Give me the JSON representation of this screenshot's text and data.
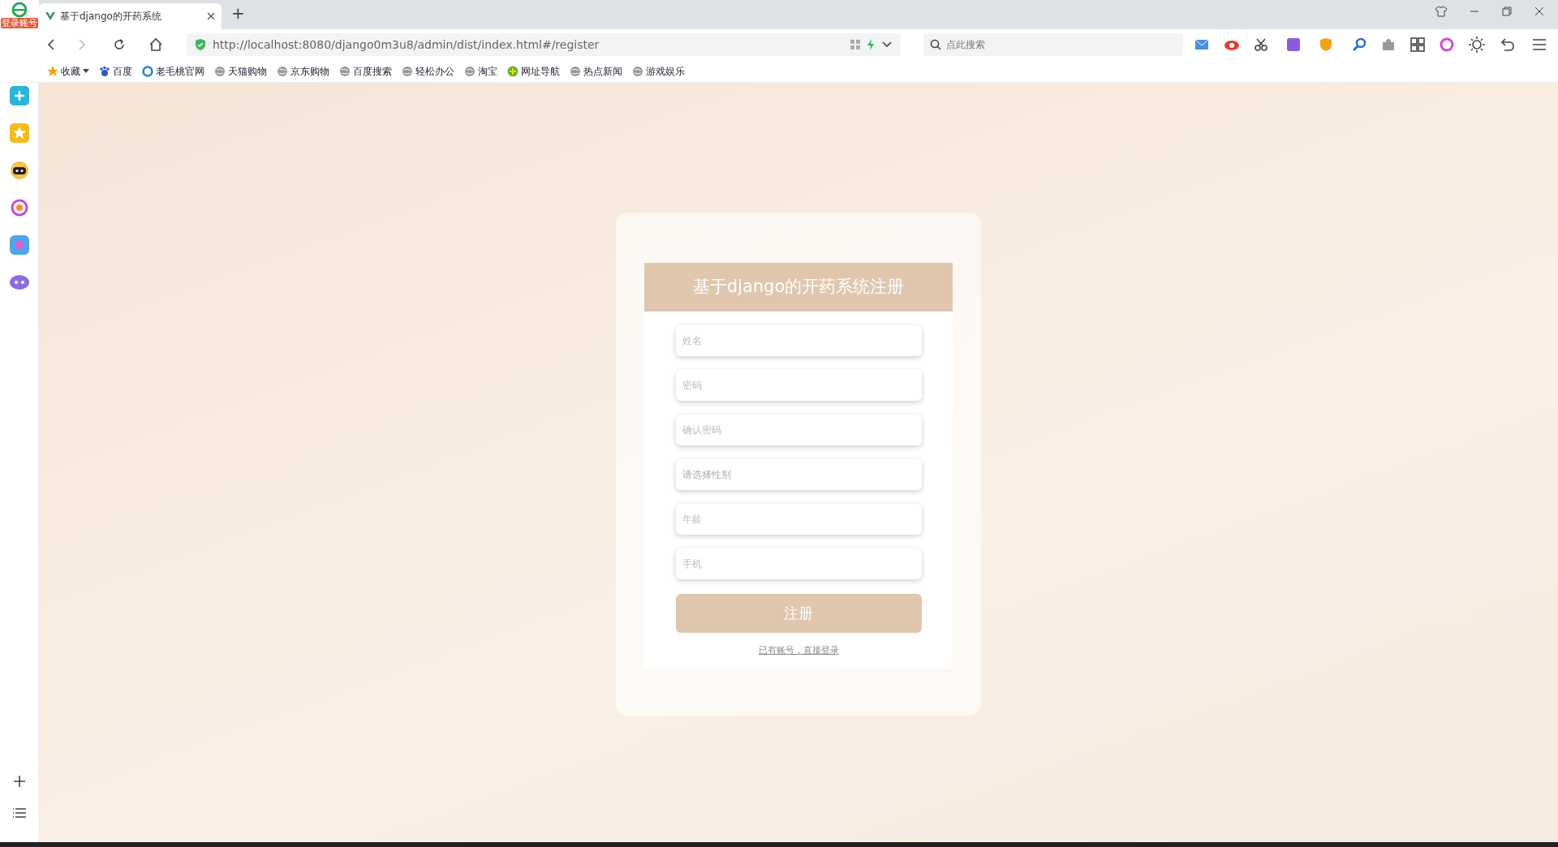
{
  "browser": {
    "login_badge": "登录账号",
    "tabs": [
      {
        "title": "基于django的开药系统",
        "selected": true
      }
    ],
    "new_tab": "+",
    "url": "http://localhost:8080/django0m3u8/admin/dist/index.html#/register",
    "search": {
      "placeholder": "点此搜索"
    },
    "bookmarks": [
      {
        "label": "收藏",
        "kind": "star"
      },
      {
        "label": "百度",
        "kind": "paw"
      },
      {
        "label": "老毛桃官网",
        "kind": "ring"
      },
      {
        "label": "天猫购物",
        "kind": "globe"
      },
      {
        "label": "京东购物",
        "kind": "globe"
      },
      {
        "label": "百度搜索",
        "kind": "globe"
      },
      {
        "label": "轻松办公",
        "kind": "globe"
      },
      {
        "label": "淘宝",
        "kind": "globe"
      },
      {
        "label": "网址导航",
        "kind": "nav"
      },
      {
        "label": "热点新闻",
        "kind": "globe"
      },
      {
        "label": "游戏娱乐",
        "kind": "globe"
      }
    ]
  },
  "form": {
    "title": "基于django的开药系统注册",
    "fields": [
      {
        "placeholder": "姓名",
        "kind": "text"
      },
      {
        "placeholder": "密码",
        "kind": "password"
      },
      {
        "placeholder": "确认密码",
        "kind": "password"
      },
      {
        "placeholder": "请选择性别",
        "kind": "select"
      },
      {
        "placeholder": "年龄",
        "kind": "text"
      },
      {
        "placeholder": "手机",
        "kind": "text"
      }
    ],
    "submit": "注册",
    "login_link": "已有账号，直接登录"
  }
}
